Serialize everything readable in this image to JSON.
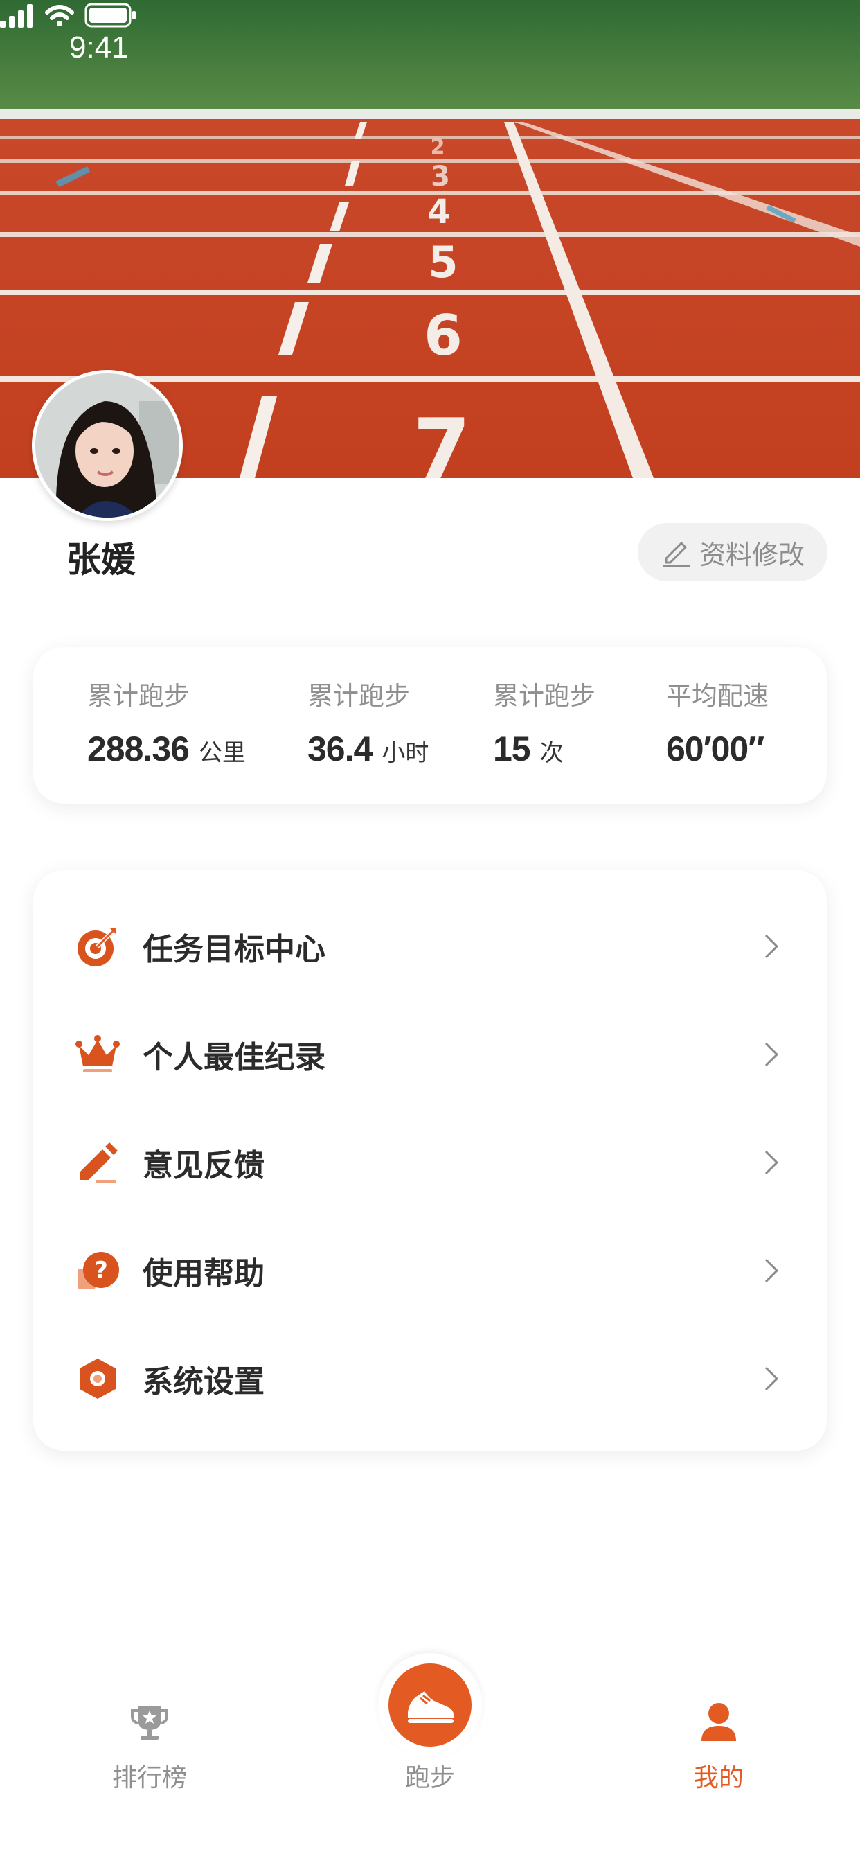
{
  "status_bar": {
    "time": "9:41"
  },
  "profile": {
    "name": "张媛",
    "edit_label": "资料修改"
  },
  "stats": [
    {
      "label": "累计跑步",
      "value": "288.36",
      "unit": "公里"
    },
    {
      "label": "累计跑步",
      "value": "36.4",
      "unit": "小时"
    },
    {
      "label": "累计跑步",
      "value": "15",
      "unit": "次"
    },
    {
      "label": "平均配速",
      "value": "60′00″",
      "unit": ""
    }
  ],
  "menu": [
    {
      "label": "任务目标中心",
      "icon": "target-icon"
    },
    {
      "label": "个人最佳纪录",
      "icon": "crown-icon"
    },
    {
      "label": "意见反馈",
      "icon": "pencil-icon"
    },
    {
      "label": "使用帮助",
      "icon": "help-icon"
    },
    {
      "label": "系统设置",
      "icon": "settings-icon"
    }
  ],
  "tabbar": {
    "items": [
      {
        "label": "排行榜",
        "icon": "trophy-icon",
        "active": false
      },
      {
        "label": "跑步",
        "icon": "shoe-icon",
        "active": false
      },
      {
        "label": "我的",
        "icon": "user-icon",
        "active": true
      }
    ]
  },
  "colors": {
    "accent": "#e35b22",
    "track": "#c8472a",
    "grass": "#3f7a3c",
    "inactive": "#8f8f8f"
  }
}
